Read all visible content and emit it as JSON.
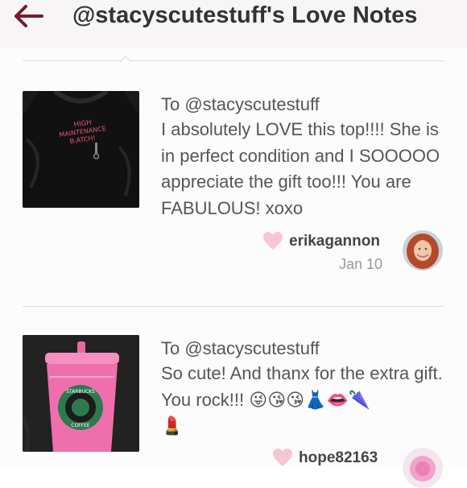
{
  "header": {
    "title": "@stacyscutestuff's Love Notes",
    "back_icon": "back-arrow-icon",
    "accent_color": "#7b1c2e"
  },
  "notes": [
    {
      "to": "To @stacyscutestuff",
      "message": "I absolutely LOVE this top!!!! She is in perfect condition and I SOOOOO appreciate the gift too!!! You are FABULOUS! xoxo",
      "image_text": "HIGH MAINTENANCE B-ATCH!",
      "username": "erikagannon",
      "date": "Jan 10",
      "heart_icon": "heart-icon",
      "heart_color": "#f7c6d3"
    },
    {
      "to": "To @stacyscutestuff",
      "message": "So cute! And thanx for the extra gift. You rock!!!",
      "emojis": "😜😘😘👗👄🌂",
      "emoji_line2": "💄",
      "image_text": "STARBUCKS COFFEE",
      "username": "hope82163",
      "heart_icon": "heart-icon",
      "heart_color": "#f7c6d3"
    }
  ]
}
